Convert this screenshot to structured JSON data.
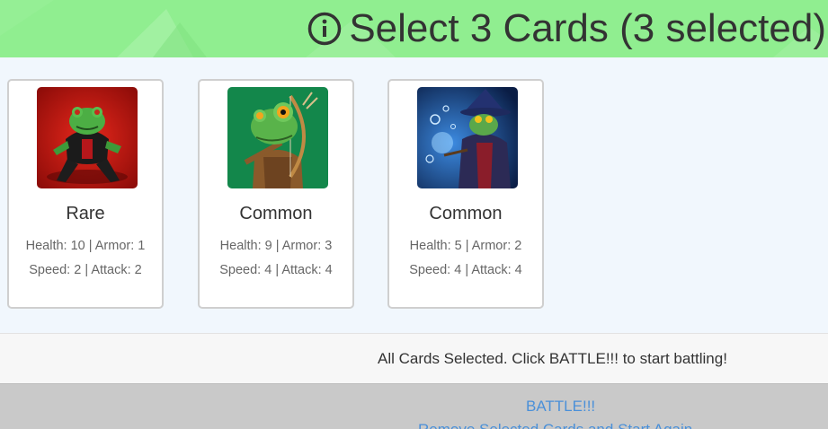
{
  "header": {
    "title": "Select 3 Cards (3 selected)",
    "icon": "info-circle-icon",
    "bg_color": "#90ee90"
  },
  "cards": [
    {
      "rarity": "Rare",
      "stats_line1": "Health: 10 | Armor: 1",
      "stats_line2": "Speed: 2 | Attack: 2",
      "image": "frog-fighter-image"
    },
    {
      "rarity": "Common",
      "stats_line1": "Health: 9 | Armor: 3",
      "stats_line2": "Speed: 4 | Attack: 4",
      "image": "frog-archer-image"
    },
    {
      "rarity": "Common",
      "stats_line1": "Health: 5 | Armor: 2",
      "stats_line2": "Speed: 4 | Attack: 4",
      "image": "frog-wizard-image"
    }
  ],
  "status": {
    "message": "All Cards Selected. Click BATTLE!!! to start battling!"
  },
  "actions": {
    "battle_label": "BATTLE!!!",
    "reset_label": "Remove Selected Cards and Start Again",
    "link_color": "#4a90d9"
  }
}
